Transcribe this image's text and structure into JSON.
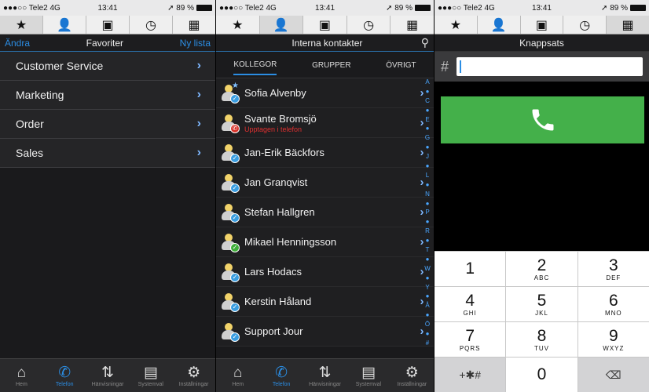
{
  "status": {
    "carrier": "●●●○○ Tele2  4G",
    "time": "13:41",
    "battery": "➚ 89 %"
  },
  "tabs": [
    {
      "icon": "star-icon",
      "glyph": "★"
    },
    {
      "icon": "person-icon",
      "glyph": "👤"
    },
    {
      "icon": "contact-card-icon",
      "glyph": "▣"
    },
    {
      "icon": "clock-icon",
      "glyph": "◷"
    },
    {
      "icon": "keypad-grid-icon",
      "glyph": "▦"
    }
  ],
  "favorites": {
    "edit": "Ändra",
    "title": "Favoriter",
    "new_list": "Ny lista",
    "items": [
      "Customer Service",
      "Marketing",
      "Order",
      "Sales"
    ]
  },
  "contacts": {
    "title": "Interna kontakter",
    "segments": [
      "KOLLEGOR",
      "GRUPPER",
      "ÖVRIGT"
    ],
    "items": [
      {
        "name": "Sofia Alvenby",
        "sub": "",
        "badge": "blue",
        "star": true
      },
      {
        "name": "Svante Bromsjö",
        "sub": "Upptagen i telefon",
        "badge": "red",
        "star": false
      },
      {
        "name": "Jan-Erik Bäckfors",
        "sub": "",
        "badge": "blue",
        "star": false
      },
      {
        "name": "Jan Granqvist",
        "sub": "",
        "badge": "blue",
        "star": false
      },
      {
        "name": "Stefan Hallgren",
        "sub": "",
        "badge": "blue",
        "star": false
      },
      {
        "name": "Mikael Henningsson",
        "sub": "",
        "badge": "green",
        "star": false
      },
      {
        "name": "Lars Hodacs",
        "sub": "",
        "badge": "blue",
        "star": false
      },
      {
        "name": "Kerstin Håland",
        "sub": "",
        "badge": "blue",
        "star": false
      },
      {
        "name": "Support Jour",
        "sub": "",
        "badge": "blue",
        "star": false
      }
    ],
    "index": [
      "A",
      "●",
      "C",
      "●",
      "E",
      "●",
      "G",
      "●",
      "J",
      "●",
      "L",
      "●",
      "N",
      "●",
      "P",
      "●",
      "R",
      "●",
      "T",
      "●",
      "W",
      "●",
      "Y",
      "●",
      "Å",
      "●",
      "Ö",
      "●",
      "#"
    ]
  },
  "bottom_nav": [
    {
      "label": "Hem",
      "glyph": "⌂",
      "icon": "home-icon"
    },
    {
      "label": "Telefon",
      "glyph": "✆",
      "icon": "phone-icon"
    },
    {
      "label": "Hänvisningar",
      "glyph": "⇅",
      "icon": "redirect-icon"
    },
    {
      "label": "Systemval",
      "glyph": "▤",
      "icon": "system-icon"
    },
    {
      "label": "Inställningar",
      "glyph": "⚙",
      "icon": "settings-icon"
    }
  ],
  "keypad": {
    "title": "Knappsats",
    "prefix": "#",
    "keys": [
      [
        {
          "n": "1",
          "l": ""
        },
        {
          "n": "2",
          "l": "ABC"
        },
        {
          "n": "3",
          "l": "DEF"
        }
      ],
      [
        {
          "n": "4",
          "l": "GHI"
        },
        {
          "n": "5",
          "l": "JKL"
        },
        {
          "n": "6",
          "l": "MNO"
        }
      ],
      [
        {
          "n": "7",
          "l": "PQRS"
        },
        {
          "n": "8",
          "l": "TUV"
        },
        {
          "n": "9",
          "l": "WXYZ"
        }
      ]
    ],
    "bottom_left": "+✱#",
    "zero": "0",
    "backspace": "⌫",
    "call_color": "#44b04a"
  }
}
